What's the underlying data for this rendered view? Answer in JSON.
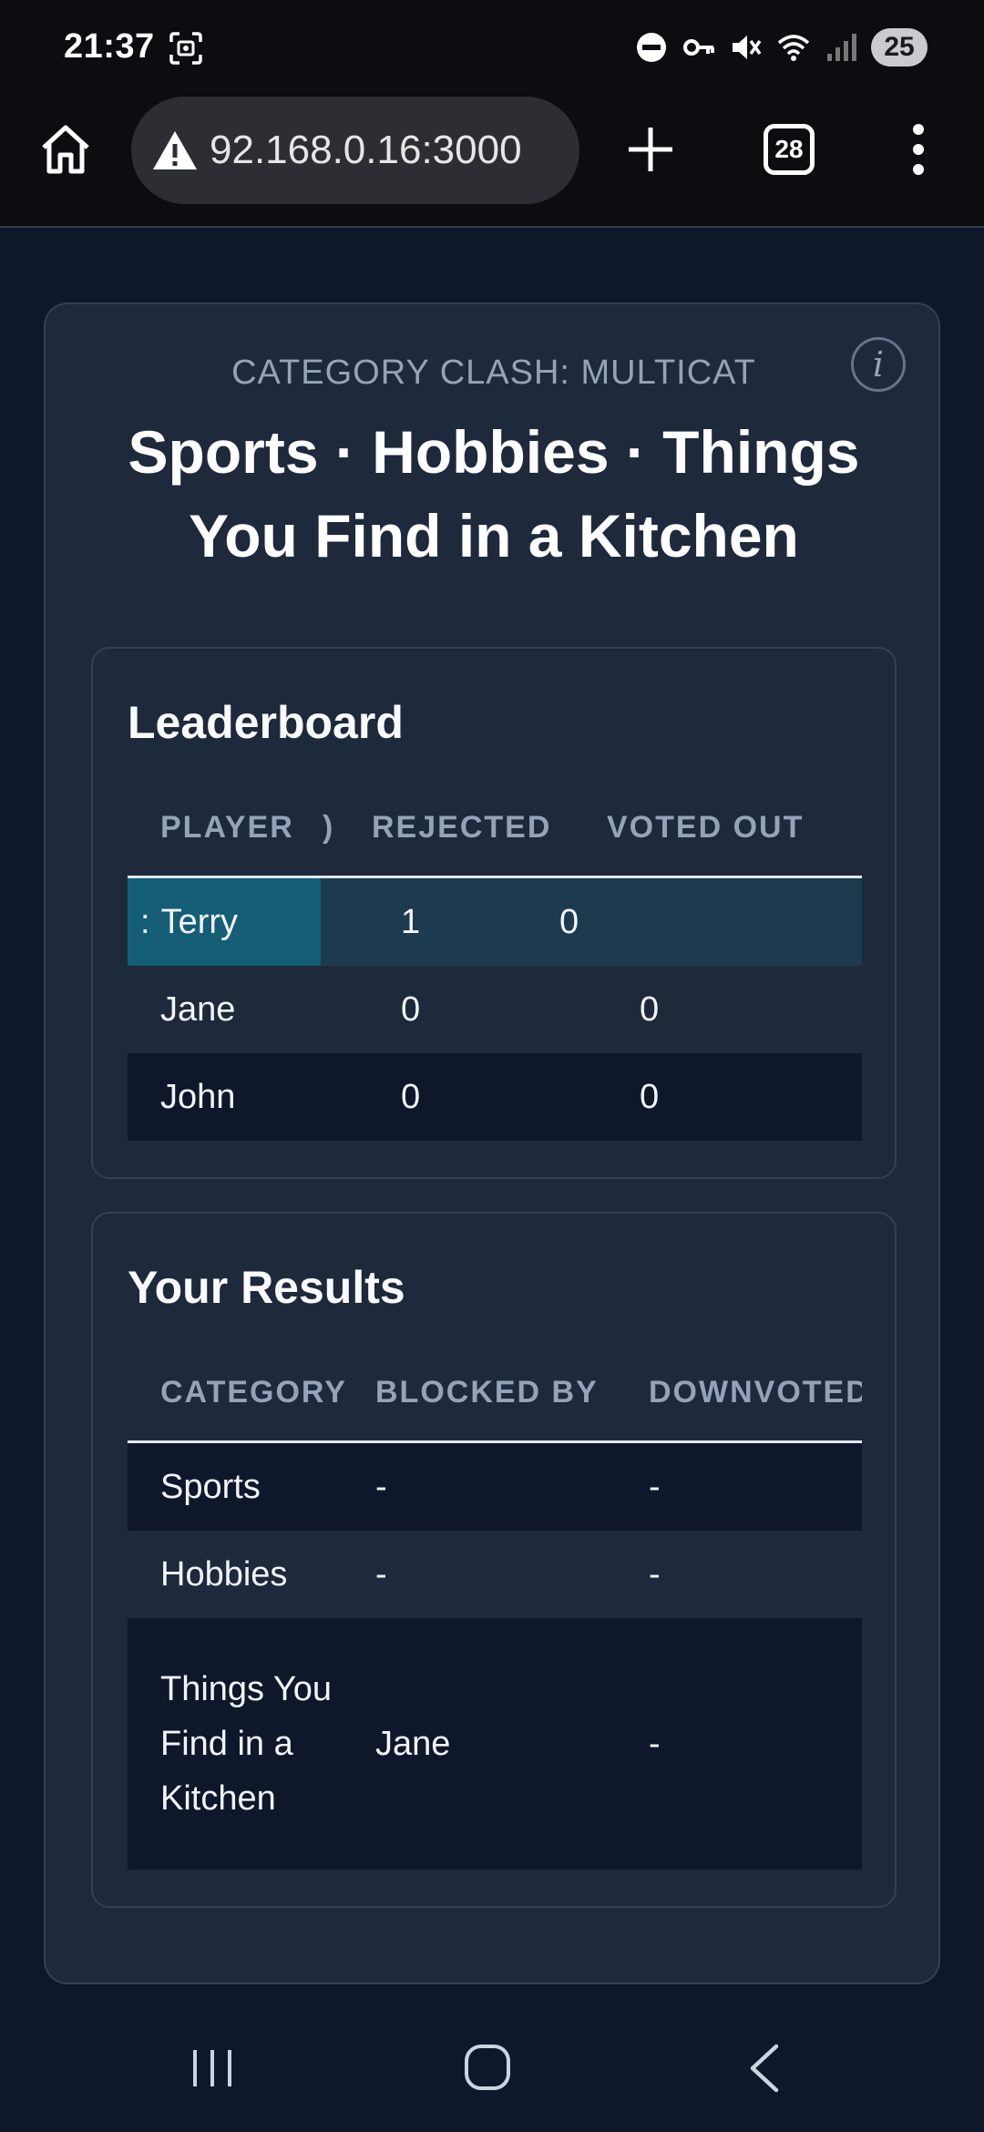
{
  "status_bar": {
    "time": "21:37",
    "battery": "25",
    "icons": [
      "screenshot-icon",
      "dnd-icon",
      "vpn-key-icon",
      "mute-icon",
      "wifi-icon",
      "signal-icon"
    ]
  },
  "browser": {
    "url": "92.168.0.16:3000",
    "tab_count": "28"
  },
  "game": {
    "label": "CATEGORY CLASH: MULTICAT",
    "title": "Sports · Hobbies · Things You Find in a Kitchen",
    "info": "i"
  },
  "leaderboard": {
    "title": "Leaderboard",
    "headers": [
      "PLAYER",
      ")",
      "REJECTED",
      "VOTED OUT"
    ],
    "rows": [
      {
        "marker": ":",
        "player": "Terry",
        "rejected": "1",
        "voted_out": "0"
      },
      {
        "player": "Jane",
        "rejected": "0",
        "voted_out": "0"
      },
      {
        "player": "John",
        "rejected": "0",
        "voted_out": "0"
      }
    ]
  },
  "results": {
    "title": "Your Results",
    "headers": [
      "CATEGORY",
      "BLOCKED BY",
      "DOWNVOTED"
    ],
    "rows": [
      {
        "category": "Sports",
        "blocked_by": "-",
        "downvoted": "-"
      },
      {
        "category": "Hobbies",
        "blocked_by": "-",
        "downvoted": "-"
      },
      {
        "category": "Things You Find in a Kitchen",
        "blocked_by": "Jane",
        "downvoted": "-"
      }
    ]
  },
  "colors": {
    "background": "#0f172a",
    "card": "#1e293b",
    "highlight_row": "#1e3a4f",
    "highlight_cell": "#155e75",
    "muted_text": "#94a3b8"
  }
}
